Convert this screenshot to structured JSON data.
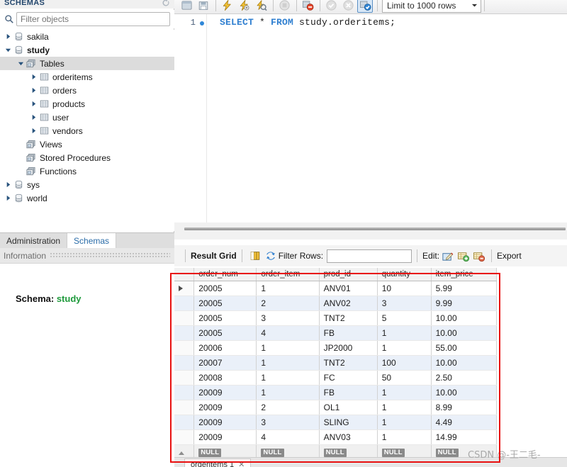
{
  "sidebar": {
    "header_title": "SCHEMAS",
    "refresh_icon": "refresh-icon",
    "search_icon": "search-icon",
    "filter_placeholder": "Filter objects",
    "filter_value": "",
    "tree": [
      {
        "label": "sakila",
        "depth": 0,
        "icon": "database-icon",
        "arrow": "collapsed",
        "bold": false,
        "selected": false
      },
      {
        "label": "study",
        "depth": 0,
        "icon": "database-icon",
        "arrow": "expanded",
        "bold": true,
        "selected": false
      },
      {
        "label": "Tables",
        "depth": 1,
        "icon": "folder-tables-icon",
        "arrow": "expanded",
        "bold": false,
        "selected": true
      },
      {
        "label": "orderitems",
        "depth": 2,
        "icon": "table-icon",
        "arrow": "collapsed",
        "bold": false,
        "selected": false
      },
      {
        "label": "orders",
        "depth": 2,
        "icon": "table-icon",
        "arrow": "collapsed",
        "bold": false,
        "selected": false
      },
      {
        "label": "products",
        "depth": 2,
        "icon": "table-icon",
        "arrow": "collapsed",
        "bold": false,
        "selected": false
      },
      {
        "label": "user",
        "depth": 2,
        "icon": "table-icon",
        "arrow": "collapsed",
        "bold": false,
        "selected": false
      },
      {
        "label": "vendors",
        "depth": 2,
        "icon": "table-icon",
        "arrow": "collapsed",
        "bold": false,
        "selected": false
      },
      {
        "label": "Views",
        "depth": 1,
        "icon": "folder-views-icon",
        "arrow": "none",
        "bold": false,
        "selected": false
      },
      {
        "label": "Stored Procedures",
        "depth": 1,
        "icon": "folder-procs-icon",
        "arrow": "none",
        "bold": false,
        "selected": false
      },
      {
        "label": "Functions",
        "depth": 1,
        "icon": "folder-funcs-icon",
        "arrow": "none",
        "bold": false,
        "selected": false
      },
      {
        "label": "sys",
        "depth": 0,
        "icon": "database-icon",
        "arrow": "collapsed",
        "bold": false,
        "selected": false
      },
      {
        "label": "world",
        "depth": 0,
        "icon": "database-icon",
        "arrow": "collapsed",
        "bold": false,
        "selected": false
      }
    ],
    "tabs": [
      {
        "label": "Administration",
        "active": false
      },
      {
        "label": "Schemas",
        "active": true
      }
    ],
    "information_label": "Information",
    "schema_prefix": "Schema:",
    "schema_name": "study"
  },
  "sql_toolbar": {
    "buttons": [
      {
        "name": "new-sql-tab-icon",
        "enabled": true,
        "active": false
      },
      {
        "name": "save-script-icon",
        "enabled": true,
        "active": false
      },
      {
        "name": "execute-statement-icon",
        "enabled": true,
        "active": false
      },
      {
        "name": "execute-current-icon",
        "enabled": true,
        "active": false
      },
      {
        "name": "explain-query-icon",
        "enabled": true,
        "active": false
      },
      {
        "name": "stop-execution-icon",
        "enabled": false,
        "active": false
      },
      {
        "name": "toggle-stop-on-error-icon",
        "enabled": true,
        "active": false
      },
      {
        "name": "commit-transaction-icon",
        "enabled": false,
        "active": false
      },
      {
        "name": "rollback-transaction-icon",
        "enabled": false,
        "active": false
      },
      {
        "name": "autocommit-toggle-icon",
        "enabled": true,
        "active": true
      }
    ],
    "limit_label": "Limit to 1000 rows",
    "limit_caret": "chevron-down-icon"
  },
  "editor": {
    "line_number": "1",
    "breakpoint_marker": "statement-marker-dot",
    "sql_keyword_select": "SELECT",
    "sql_star": " * ",
    "sql_keyword_from": "FROM",
    "sql_target": " study.orderitems;"
  },
  "result_toolbar": {
    "title": "Result Grid",
    "grid_view_icon": "grid-view-icon",
    "refresh_icon": "refresh-grid-icon",
    "filter_rows_label": "Filter Rows:",
    "filter_rows_value": "",
    "edit_label": "Edit:",
    "edit_row_icon": "edit-row-icon",
    "insert_row_icon": "insert-row-icon",
    "delete_row_icon": "delete-row-icon",
    "export_label": "Export"
  },
  "result_grid": {
    "columns": [
      "order_num",
      "order_item",
      "prod_id",
      "quantity",
      "item_price"
    ],
    "rows": [
      {
        "cells": [
          "20005",
          "1",
          "ANV01",
          "10",
          "5.99"
        ],
        "current": true
      },
      {
        "cells": [
          "20005",
          "2",
          "ANV02",
          "3",
          "9.99"
        ],
        "current": false
      },
      {
        "cells": [
          "20005",
          "3",
          "TNT2",
          "5",
          "10.00"
        ],
        "current": false
      },
      {
        "cells": [
          "20005",
          "4",
          "FB",
          "1",
          "10.00"
        ],
        "current": false
      },
      {
        "cells": [
          "20006",
          "1",
          "JP2000",
          "1",
          "55.00"
        ],
        "current": false
      },
      {
        "cells": [
          "20007",
          "1",
          "TNT2",
          "100",
          "10.00"
        ],
        "current": false
      },
      {
        "cells": [
          "20008",
          "1",
          "FC",
          "50",
          "2.50"
        ],
        "current": false
      },
      {
        "cells": [
          "20009",
          "1",
          "FB",
          "1",
          "10.00"
        ],
        "current": false
      },
      {
        "cells": [
          "20009",
          "2",
          "OL1",
          "1",
          "8.99"
        ],
        "current": false
      },
      {
        "cells": [
          "20009",
          "3",
          "SLING",
          "1",
          "4.49"
        ],
        "current": false
      },
      {
        "cells": [
          "20009",
          "4",
          "ANV03",
          "1",
          "14.99"
        ],
        "current": false
      }
    ],
    "null_placeholder": "NULL"
  },
  "bottom_tab": {
    "label": "orderitems 1",
    "close_icon": "close-icon"
  },
  "watermark": {
    "text": "CSDN @-王二毛-"
  },
  "colors": {
    "accent_blue": "#2f7fd0",
    "schema_green": "#1f9a3c",
    "annotation_red": "#e81010",
    "row_alt": "#eaf0f9",
    "selected_tree": "#dcdcdc"
  }
}
